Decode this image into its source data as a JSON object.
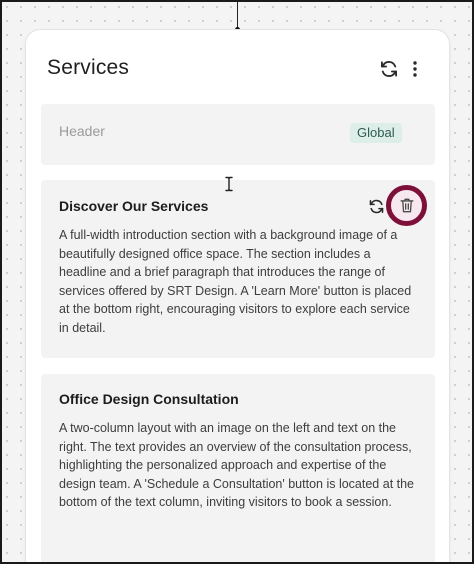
{
  "panel": {
    "title": "Services",
    "refresh_icon": "refresh-icon",
    "more_icon": "more-vertical-icon"
  },
  "header_card": {
    "label": "Header",
    "badge": "Global"
  },
  "sections": [
    {
      "title": "Discover Our Services",
      "description": "A full-width introduction section with a background image of a beautifully designed office space. The section includes a headline and a brief paragraph that introduces the range of services offered by SRT Design. A 'Learn More' button is placed at the bottom right, encouraging visitors to explore each service in detail.",
      "actions": [
        "refresh-icon",
        "trash-icon"
      ]
    },
    {
      "title": "Office Design Consultation",
      "description": "A two-column layout with an image on the left and text on the right. The text provides an overview of the consultation process, highlighting the personalized approach and expertise of the design team. A 'Schedule a Consultation' button is located at the bottom of the text column, inviting visitors to book a session."
    }
  ],
  "colors": {
    "highlight_ring": "#7e0f38",
    "badge_bg": "#ddeee9",
    "badge_text": "#2e5b52",
    "card_bg": "#f3f3f3"
  }
}
